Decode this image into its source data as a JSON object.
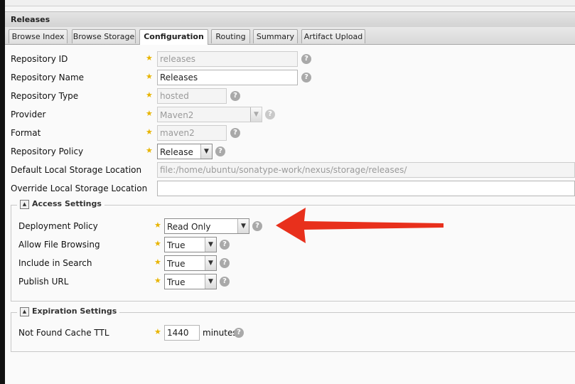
{
  "panel": {
    "title": "Releases"
  },
  "tabs": [
    {
      "label": "Browse Index"
    },
    {
      "label": "Browse Storage"
    },
    {
      "label": "Configuration"
    },
    {
      "label": "Routing"
    },
    {
      "label": "Summary"
    },
    {
      "label": "Artifact Upload"
    }
  ],
  "active_tab": "Configuration",
  "form": {
    "repo_id": {
      "label": "Repository ID",
      "value": "releases"
    },
    "repo_name": {
      "label": "Repository Name",
      "value": "Releases"
    },
    "repo_type": {
      "label": "Repository Type",
      "value": "hosted"
    },
    "provider": {
      "label": "Provider",
      "value": "Maven2"
    },
    "format": {
      "label": "Format",
      "value": "maven2"
    },
    "repo_policy": {
      "label": "Repository Policy",
      "value": "Release"
    },
    "default_storage": {
      "label": "Default Local Storage Location",
      "value": "file:/home/ubuntu/sonatype-work/nexus/storage/releases/"
    },
    "override_storage": {
      "label": "Override Local Storage Location",
      "value": ""
    }
  },
  "access_settings": {
    "legend": "Access Settings",
    "deployment_policy": {
      "label": "Deployment Policy",
      "value": "Read Only"
    },
    "allow_browsing": {
      "label": "Allow File Browsing",
      "value": "True"
    },
    "include_search": {
      "label": "Include in Search",
      "value": "True"
    },
    "publish_url": {
      "label": "Publish URL",
      "value": "True"
    }
  },
  "expiration_settings": {
    "legend": "Expiration Settings",
    "not_found_ttl": {
      "label": "Not Found Cache TTL",
      "value": "1440",
      "unit": "minutes"
    }
  },
  "icons": {
    "required": "star-icon",
    "help": "help-icon",
    "collapse": "collapse-icon",
    "dropdown": "chevron-down-icon",
    "annotation": "red-arrow"
  },
  "colors": {
    "required_star": "#e8b400",
    "annotation_arrow": "#e8301c",
    "help_icon": "#a9a9a9"
  }
}
